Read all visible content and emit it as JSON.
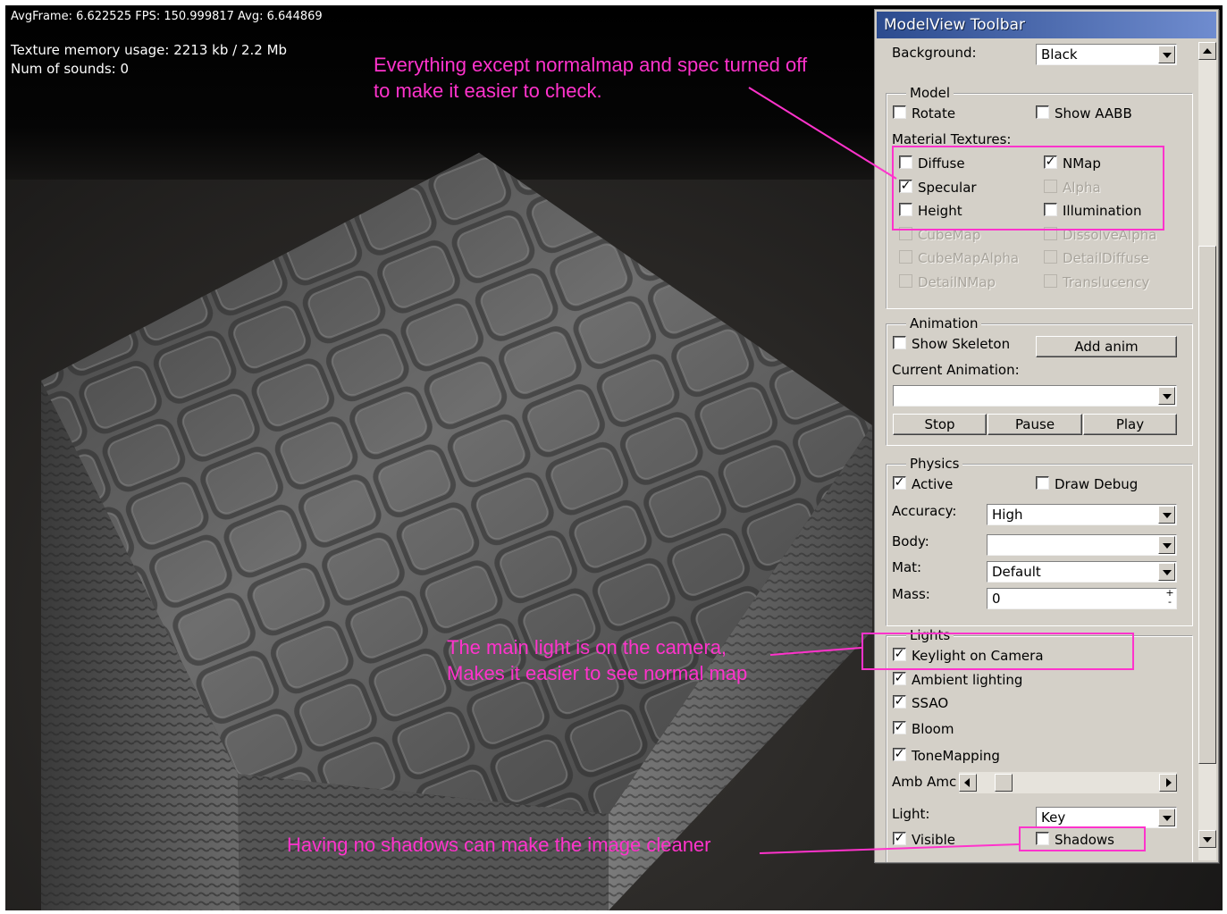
{
  "hud": {
    "line1": "AvgFrame: 6.622525  FPS: 150.999817 Avg: 6.644869",
    "line2": "Texture memory usage: 2213 kb / 2.2 Mb",
    "line3": "Num of sounds: 0"
  },
  "annotations": {
    "top_line1": "Everything except normalmap and spec turned off",
    "top_line2": "to make it easier to check.",
    "mid_line1": "The main light is on the camera,",
    "mid_line2": "Makes it easier to see normal map",
    "bottom": "Having no shadows can make the image cleaner"
  },
  "colors": {
    "annotation": "#ff33cc",
    "panel_bg": "#d4d0c8",
    "title_bar": "#2c4b8e"
  },
  "panel": {
    "title": "ModelView Toolbar",
    "background_label": "Background:",
    "background_value": "Black",
    "model": {
      "title": "Model",
      "rotate": "Rotate",
      "show_aabb": "Show AABB",
      "material_textures": "Material Textures:",
      "diffuse": "Diffuse",
      "nmap": "NMap",
      "specular": "Specular",
      "alpha": "Alpha",
      "height": "Height",
      "illumination": "Illumination",
      "cubemap": "CubeMap",
      "dissolvealpha": "DissolveAlpha",
      "cubemapalpha": "CubeMapAlpha",
      "detaildiffuse": "DetailDiffuse",
      "detailnmap": "DetailNMap",
      "translucency": "Translucency"
    },
    "animation": {
      "title": "Animation",
      "show_skeleton": "Show Skeleton",
      "add_anim": "Add anim",
      "current_animation": "Current Animation:",
      "current_value": "",
      "stop": "Stop",
      "pause": "Pause",
      "play": "Play"
    },
    "physics": {
      "title": "Physics",
      "active": "Active",
      "draw_debug": "Draw Debug",
      "accuracy_label": "Accuracy:",
      "accuracy_value": "High",
      "body_label": "Body:",
      "body_value": "",
      "mat_label": "Mat:",
      "mat_value": "Default",
      "mass_label": "Mass:",
      "mass_value": "0"
    },
    "lights": {
      "title": "Lights",
      "keylight": "Keylight on Camera",
      "ambient": "Ambient lighting",
      "ssao": "SSAO",
      "bloom": "Bloom",
      "tonemapping": "ToneMapping",
      "amb_amount": "Amb Amc",
      "light_label": "Light:",
      "light_value": "Key",
      "visible": "Visible",
      "shadows": "Shadows"
    },
    "checks": {
      "rotate": false,
      "show_aabb": false,
      "diffuse": false,
      "nmap": true,
      "specular": true,
      "alpha": false,
      "height": false,
      "illumination": false,
      "show_skeleton": false,
      "active": true,
      "draw_debug": false,
      "keylight": true,
      "ambient": true,
      "ssao": true,
      "bloom": true,
      "tonemapping": true,
      "visible": true,
      "shadows": false
    },
    "check_mark": "✓",
    "spin_up": "+",
    "spin_down": "-"
  }
}
